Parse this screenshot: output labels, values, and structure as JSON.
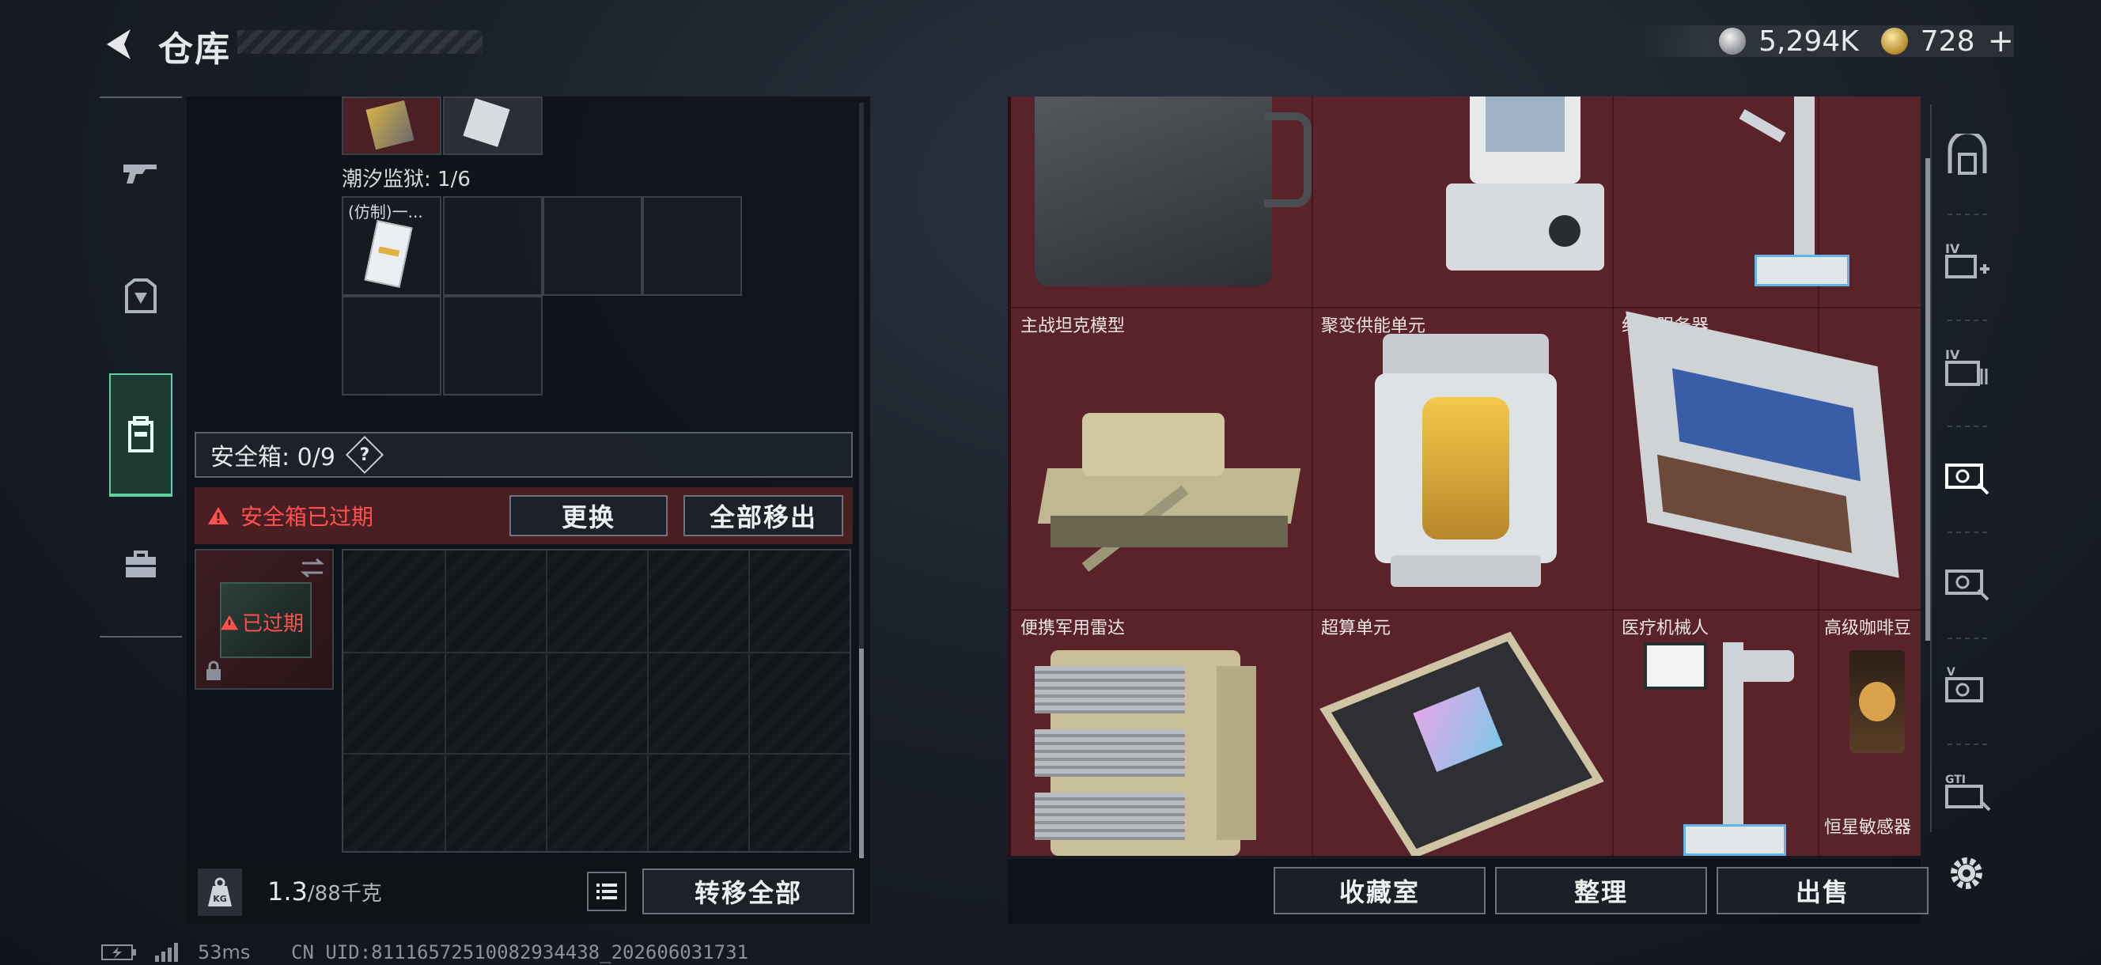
{
  "header": {
    "title": "仓库",
    "currency_silver": "5,294K",
    "currency_gold": "728",
    "add_symbol": "+"
  },
  "left_nav": [
    {
      "icon": "rifle-icon"
    },
    {
      "icon": "armor-icon"
    },
    {
      "icon": "backpack-icon"
    },
    {
      "icon": "briefcase-icon"
    }
  ],
  "storage": {
    "prison_label": "潮汐监狱: 1/6",
    "card_label": "(仿制)一..."
  },
  "safebox": {
    "label": "安全箱: 0/9",
    "help": "?",
    "expired_message": "安全箱已过期",
    "replace_button": "更换",
    "remove_all_button": "全部移出",
    "slot_status": "已过期"
  },
  "footer_left": {
    "weight_value": "1.3",
    "weight_max": "/88千克",
    "weight_icon_text": "KG",
    "transfer_all_button": "转移全部"
  },
  "collection_items": [
    {
      "name": ""
    },
    {
      "name": ""
    },
    {
      "name": ""
    },
    {
      "name": "主战坦克模型"
    },
    {
      "name": "聚变供能单元"
    },
    {
      "name": "绝密服务器"
    },
    {
      "name": "便携军用雷达"
    },
    {
      "name": "超算单元"
    },
    {
      "name": "医疗机械人"
    },
    {
      "name": "高级咖啡豆"
    },
    {
      "name": "恒星敏感器"
    }
  ],
  "right_footer": {
    "collection_button": "收藏室",
    "organize_button": "整理",
    "sell_button": "出售"
  },
  "right_nav": [
    {
      "icon": "vault-icon",
      "label": ""
    },
    {
      "icon": "level-4-plus-icon",
      "label": "IV"
    },
    {
      "icon": "level-4-icon",
      "label": "IV"
    },
    {
      "icon": "level-5-ticket-icon",
      "label": ""
    },
    {
      "icon": "level-5-ticket-icon",
      "label": ""
    },
    {
      "icon": "level-5-ticket-icon",
      "label": "V"
    },
    {
      "icon": "gti-icon",
      "label": "GTI"
    }
  ],
  "status_bar": {
    "ping": "53ms",
    "uid": "CN UID:8111657251008293443­8_202606031731"
  },
  "colors": {
    "accent_green": "#5fd0a0",
    "warning_red": "#ff4f4f",
    "collection_bg": "#5a2329"
  }
}
